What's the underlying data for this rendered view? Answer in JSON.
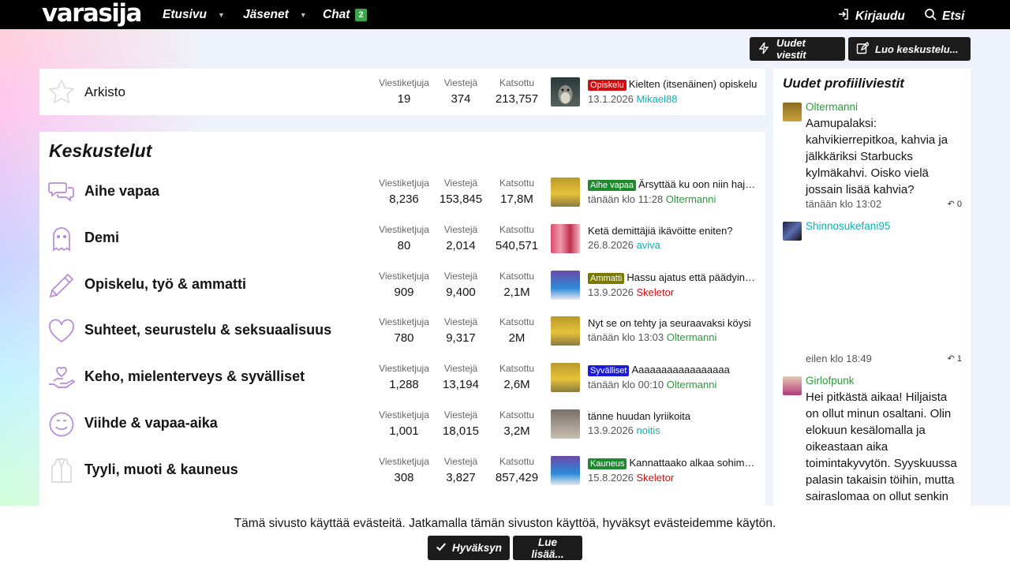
{
  "nav": {
    "logo": "varasija",
    "home": "Etusivu",
    "members": "Jäsenet",
    "chat": "Chat",
    "chat_badge": "2",
    "login": "Kirjaudu",
    "search": "Etsi"
  },
  "actions": {
    "new_posts": "Uudet viestit",
    "create_thread": "Luo keskustelu..."
  },
  "archive": {
    "title": "Arkisto",
    "threads_label": "Viestiketjuja",
    "threads": "19",
    "posts_label": "Viestejä",
    "posts": "374",
    "views_label": "Katsottu",
    "views": "213,757",
    "tag": "Opiskelu",
    "tag_color": "#d01010",
    "latest_title": "Kielten (itsenäinen) opiskelu",
    "date": "13.1.2026",
    "user": "Mikael88"
  },
  "section_title": "Keskustelut",
  "stat_labels": {
    "threads": "Viestiketjuja",
    "posts": "Viestejä",
    "views": "Katsottu"
  },
  "forums": [
    {
      "icon": "chat-bubbles-icon",
      "title": "Aihe vapaa",
      "threads": "8,236",
      "posts": "153,845",
      "views": "17,8M",
      "tag": "Aihe vapaa",
      "tag_color": "#1e8a2e",
      "latest_title": "Ärsyttää ku oon niin hajamielinen",
      "date": "tänään klo 11:28",
      "user": "Oltermanni",
      "user_color": "green"
    },
    {
      "icon": "ghost-icon",
      "title": "Demi",
      "threads": "80",
      "posts": "2,014",
      "views": "540,571",
      "tag": "",
      "tag_color": "",
      "latest_title": "Ketä demittäjiä ikävöitte eniten?",
      "date": "26.8.2026",
      "user": "aviva",
      "user_color": "teal"
    },
    {
      "icon": "pencil-icon",
      "title": "Opiskelu, työ & ammatti",
      "threads": "909",
      "posts": "9,400",
      "views": "2,1M",
      "tag": "Ammatti",
      "tag_color": "#7a7a00",
      "latest_title": "Hassu ajatus että päädyin tänne",
      "date": "13.9.2026",
      "user": "Skeletor",
      "user_color": "red"
    },
    {
      "icon": "heart-icon",
      "title": "Suhteet, seurustelu & seksuaalisuus",
      "threads": "780",
      "posts": "9,317",
      "views": "2M",
      "tag": "",
      "tag_color": "",
      "latest_title": "Nyt se on tehty ja seuraavaksi köysi",
      "date": "tänään klo 13:03",
      "user": "Oltermanni",
      "user_color": "green"
    },
    {
      "icon": "hand-heart-icon",
      "title": "Keho, mielenterveys & syvälliset",
      "threads": "1,288",
      "posts": "13,194",
      "views": "2,6M",
      "tag": "Syvälliset",
      "tag_color": "#1a1adc",
      "latest_title": "Aaaaaaaaaaaaaaaaa",
      "date": "tänään klo 00:10",
      "user": "Oltermanni",
      "user_color": "green"
    },
    {
      "icon": "smile-icon",
      "title": "Viihde & vapaa-aika",
      "threads": "1,001",
      "posts": "18,015",
      "views": "3,2M",
      "tag": "",
      "tag_color": "",
      "latest_title": "tänne huudan lyriikoita",
      "date": "13.9.2026",
      "user": "noitis",
      "user_color": "teal"
    },
    {
      "icon": "vest-icon",
      "title": "Tyyli, muoti & kauneus",
      "threads": "308",
      "posts": "3,827",
      "views": "857,429",
      "tag": "Kauneus",
      "tag_color": "#1e8a2e",
      "latest_title": "Kannattaako alkaa sohimaan",
      "date": "15.8.2026",
      "user": "Skeletor",
      "user_color": "red"
    }
  ],
  "sidebar": {
    "title": "Uudet profiiliviestit",
    "messages": [
      {
        "user": "Oltermanni",
        "text": "Aamupalaksi: kahvikierrepitkoa, kahvia ja jälkkäriksi Starbucks kylmäkahvi. Oisko vielä jossain lisää kahvia?",
        "time": "tänään klo 13:02",
        "replies": "0"
      },
      {
        "user": "Shinnosukefani95",
        "text": "",
        "time": "eilen klo 18:49",
        "replies": "1"
      },
      {
        "user": "Girlofpunk",
        "text": "Hei pitkästä aikaa! Hiljaista on ollut minun osaltani. Olin elokuun kesälomalla ja oikeastaan aika toimintakyvytön. Syyskuussa palasin takaisin töihin, mutta sairaslomaa on ollut senkin",
        "time": "",
        "replies": ""
      }
    ]
  },
  "cookie": {
    "text": "Tämä sivusto käyttää evästeitä. Jatkamalla tämän sivuston käyttöä, hyväksyt evästeidemme käytön.",
    "accept": "Hyväksyn",
    "more": "Lue lisää..."
  }
}
